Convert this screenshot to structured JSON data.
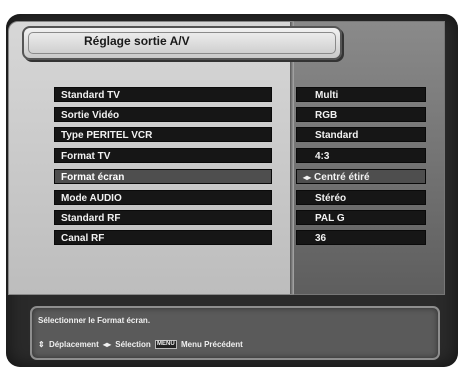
{
  "title": "Réglage sortie A/V",
  "menu": [
    {
      "label": "Standard TV",
      "value": "Multi",
      "selected": false
    },
    {
      "label": "Sortie  Vidéo",
      "value": "RGB",
      "selected": false
    },
    {
      "label": "Type PERITEL VCR",
      "value": "Standard",
      "selected": false
    },
    {
      "label": "Format TV",
      "value": "4:3",
      "selected": false
    },
    {
      "label": "Format écran",
      "value": "Centré étiré",
      "selected": true
    },
    {
      "label": "Mode AUDIO",
      "value": "Stéréo",
      "selected": false
    },
    {
      "label": "Standard RF",
      "value": "PAL G",
      "selected": false
    },
    {
      "label": "Canal RF",
      "value": "36",
      "selected": false
    }
  ],
  "help_text": "Sélectionner le Format écran.",
  "nav": {
    "updown_icon": "⇕",
    "move_label": "Déplacement",
    "leftright_icon": "◂▸",
    "select_label": "Sélection",
    "menu_key": "MENU",
    "prev_label": "Menu Précédent"
  }
}
